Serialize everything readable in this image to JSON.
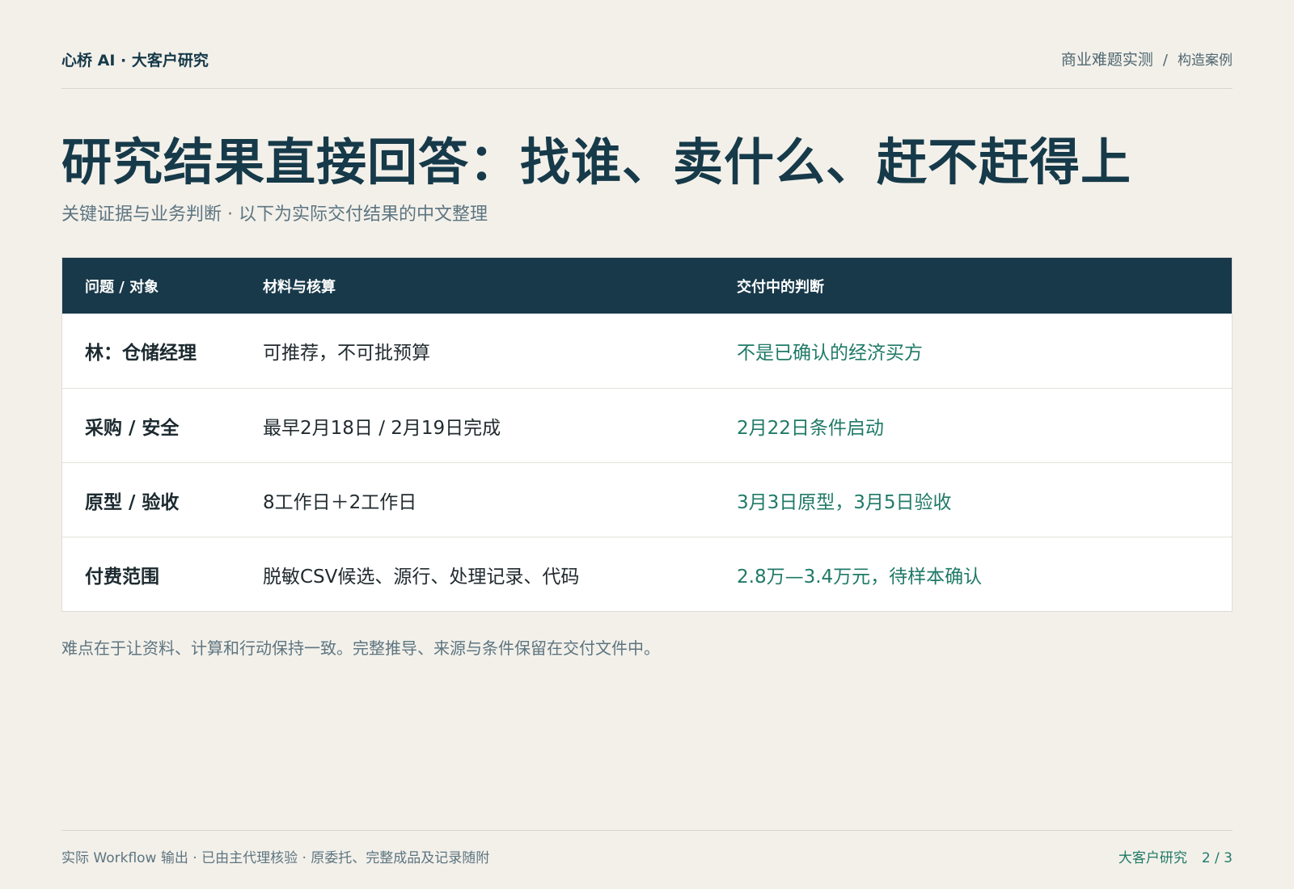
{
  "header": {
    "brand": "心桥 AI · 大客户研究",
    "section": "商业难题实测",
    "separator": "/",
    "case_label": "构造案例"
  },
  "title": "研究结果直接回答：找谁、卖什么、赶不赶得上",
  "subtitle": "关键证据与业务判断 · 以下为实际交付结果的中文整理",
  "table": {
    "headers": [
      "问题 / 对象",
      "材料与核算",
      "交付中的判断"
    ],
    "rows": [
      {
        "label": "林：仓储经理",
        "material": "可推荐，不可批预算",
        "judgement": "不是已确认的经济买方"
      },
      {
        "label": "采购 / 安全",
        "material": "最早2月18日 / 2月19日完成",
        "judgement": "2月22日条件启动"
      },
      {
        "label": "原型 / 验收",
        "material": "8工作日＋2工作日",
        "judgement": "3月3日原型，3月5日验收"
      },
      {
        "label": "付费范围",
        "material": "脱敏CSV候选、源行、处理记录、代码",
        "judgement": "2.8万—3.4万元，待样本确认"
      }
    ]
  },
  "footnote": "难点在于让资料、计算和行动保持一致。完整推导、来源与条件保留在交付文件中。",
  "footer": {
    "left": "实际 Workflow 输出 · 已由主代理核验 · 原委托、完整成品及记录随附",
    "right_label": "大客户研究",
    "page": "2 / 3"
  },
  "colors": {
    "background": "#f3f0ea",
    "primary": "#163a49",
    "table_header": "#18394a",
    "accent": "#1f7a67",
    "muted": "#5d7580"
  }
}
